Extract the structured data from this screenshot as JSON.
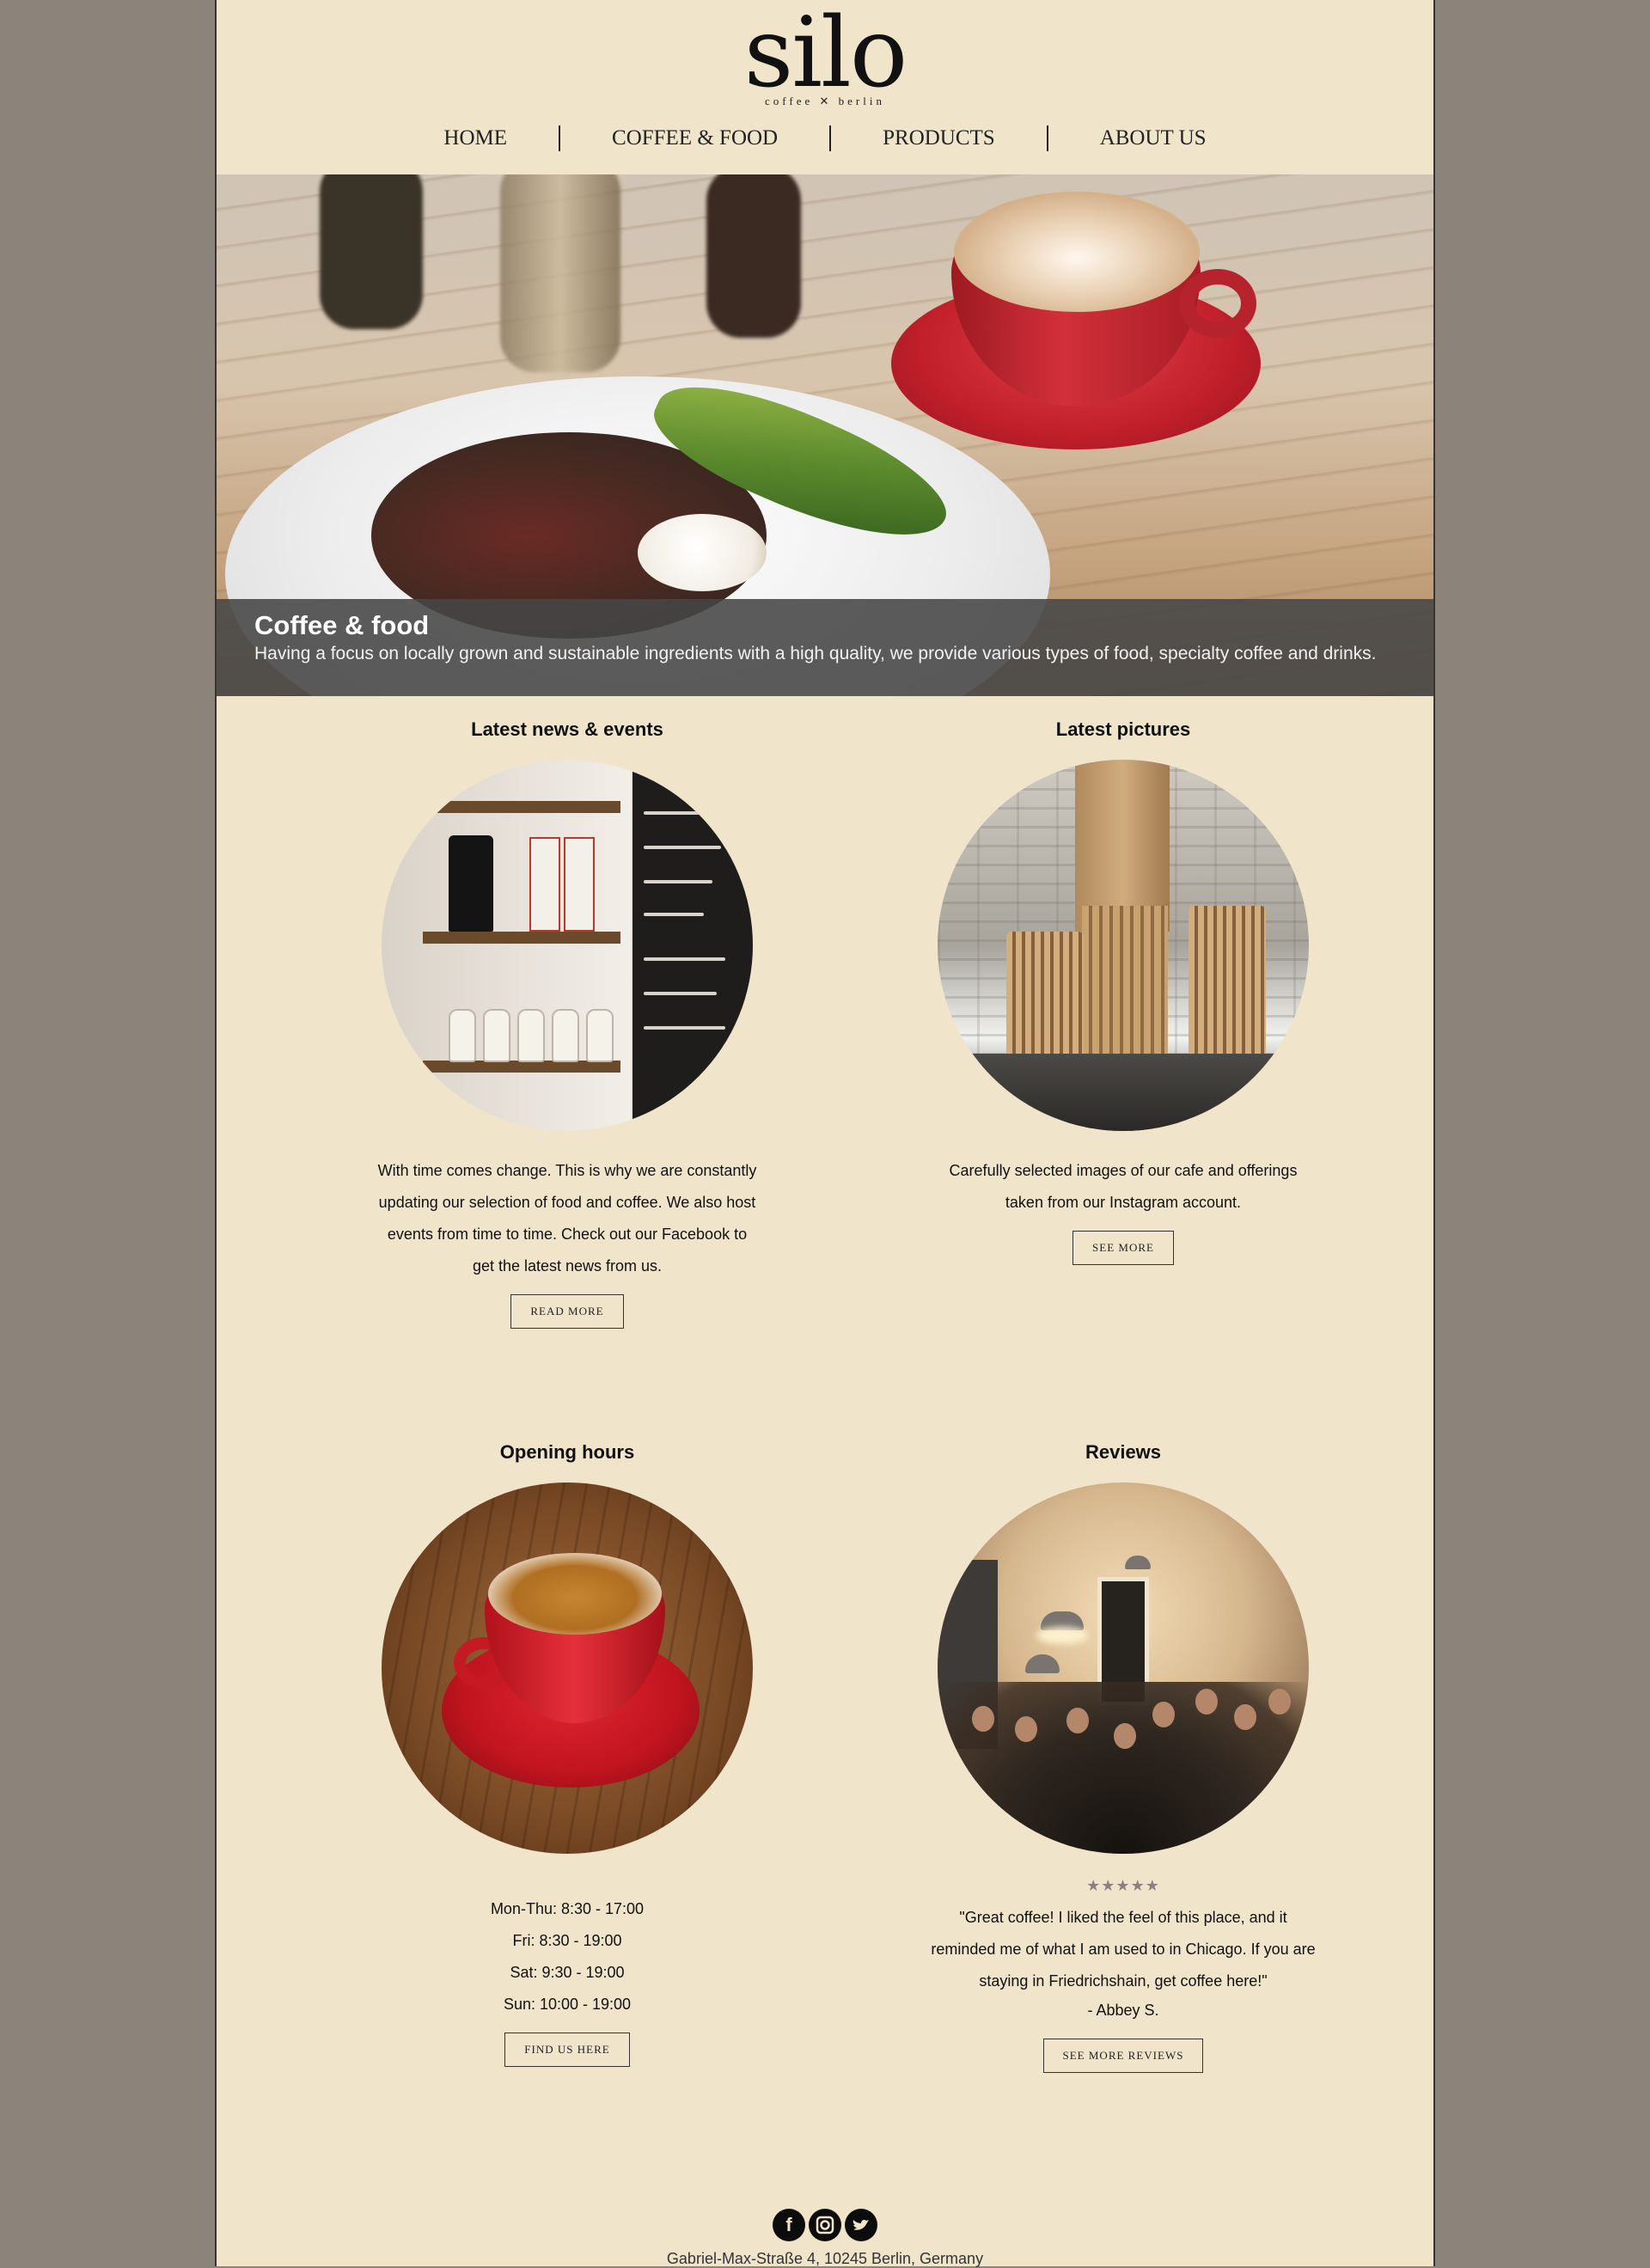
{
  "logo": {
    "word": "silo",
    "tagline": "coffee ✕ berlin"
  },
  "nav": {
    "items": [
      "HOME",
      "COFFEE & FOOD",
      "PRODUCTS",
      "ABOUT US"
    ]
  },
  "hero": {
    "title": "Coffee & food",
    "description": "Having a focus on locally grown and sustainable ingredients with a high quality, we provide various types of food, specialty coffee and drinks."
  },
  "news": {
    "title": "Latest news & events",
    "text": "With time comes change. This is why we are constantly updating our selection of food and coffee. We also host events from time to time. Check out our Facebook to get the latest news from us.",
    "button": "READ MORE"
  },
  "pictures": {
    "title": "Latest pictures",
    "text": "Carefully selected images of our cafe and offerings taken from our Instagram account.",
    "button": "SEE MORE"
  },
  "hours": {
    "title": "Opening hours",
    "lines": [
      "Mon-Thu: 8:30 - 17:00",
      "Fri: 8:30 - 19:00",
      "Sat: 9:30 - 19:00",
      "Sun: 10:00 - 19:00"
    ],
    "button": "FIND US HERE"
  },
  "reviews": {
    "title": "Reviews",
    "stars": "★★★★★",
    "quote": "\"Great coffee! I liked the feel of this place, and it reminded me of what I am used to in Chicago. If you are staying in Friedrichshain, get coffee here!\"",
    "author": "- Abbey S.",
    "button": "SEE MORE REVIEWS"
  },
  "footer": {
    "social": [
      "facebook-icon",
      "instagram-icon",
      "twitter-icon"
    ],
    "address": "Gabriel-Max-Straße 4, 10245 Berlin, Germany"
  }
}
